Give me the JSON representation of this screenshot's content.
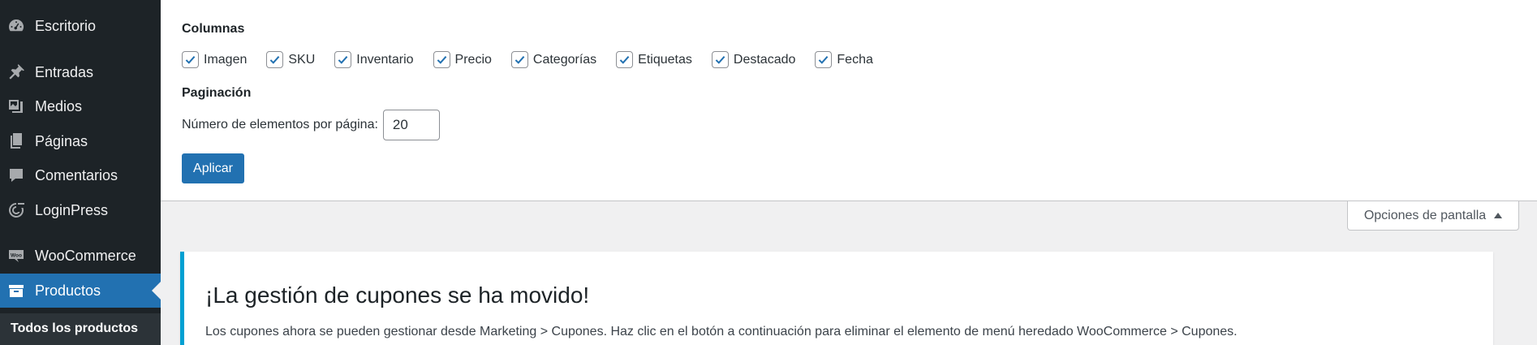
{
  "sidebar": {
    "items": [
      {
        "label": "Escritorio",
        "icon": "dashboard-icon"
      },
      {
        "label": "Entradas",
        "icon": "pin-icon"
      },
      {
        "label": "Medios",
        "icon": "media-icon"
      },
      {
        "label": "Páginas",
        "icon": "pages-icon"
      },
      {
        "label": "Comentarios",
        "icon": "comment-icon"
      },
      {
        "label": "LoginPress",
        "icon": "loginpress-icon"
      },
      {
        "label": "WooCommerce",
        "icon": "woo-icon"
      },
      {
        "label": "Productos",
        "icon": "products-icon",
        "active": true
      }
    ],
    "submenu": {
      "label": "Todos los productos"
    }
  },
  "screen_options": {
    "columns_heading": "Columnas",
    "columns": [
      {
        "label": "Imagen",
        "checked": true
      },
      {
        "label": "SKU",
        "checked": true
      },
      {
        "label": "Inventario",
        "checked": true
      },
      {
        "label": "Precio",
        "checked": true
      },
      {
        "label": "Categorías",
        "checked": true
      },
      {
        "label": "Etiquetas",
        "checked": true
      },
      {
        "label": "Destacado",
        "checked": true
      },
      {
        "label": "Fecha",
        "checked": true
      }
    ],
    "pagination_heading": "Paginación",
    "per_page_label": "Número de elementos por página:",
    "per_page_value": "20",
    "apply_label": "Aplicar",
    "toggle_label": "Opciones de pantalla"
  },
  "notice": {
    "title": "¡La gestión de cupones se ha movido!",
    "text": "Los cupones ahora se pueden gestionar desde Marketing > Cupones. Haz clic en el botón a continuación para eliminar el elemento de menú heredado WooCommerce > Cupones."
  },
  "colors": {
    "sidebar_bg": "#1d2327",
    "accent": "#2271b1",
    "notice_border": "#00a0d2"
  }
}
